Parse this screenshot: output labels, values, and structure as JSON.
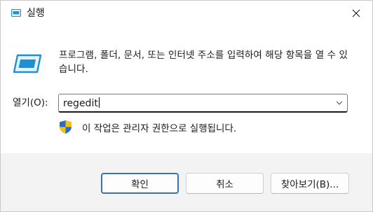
{
  "window": {
    "title": "실행",
    "close_symbol": "✕"
  },
  "content": {
    "description": "프로그램, 폴더, 문서, 또는 인터넷 주소를 입력하여 해당 항목을 열 수 있습니다.",
    "open_label": "열기(O):",
    "open_value": "regedit",
    "admin_note": "이 작업은 관리자 권한으로 실행됩니다."
  },
  "buttons": {
    "ok": "확인",
    "cancel": "취소",
    "browse": "찾아보기(B)..."
  },
  "icons": {
    "title": "run-icon",
    "app": "run-icon",
    "shield": "uac-shield-icon",
    "dropdown": "chevron-down-icon",
    "close": "close-icon"
  },
  "colors": {
    "accent": "#3b6fb6",
    "icon_blue": "#1e90d6",
    "shield_blue": "#2b6cc4",
    "shield_yellow": "#f4c20d"
  }
}
